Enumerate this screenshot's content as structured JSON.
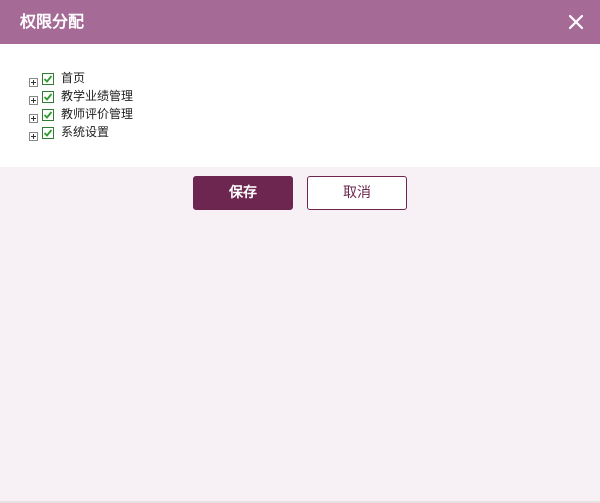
{
  "dialog": {
    "title": "权限分配",
    "close_icon": "close-icon"
  },
  "tree": {
    "items": [
      {
        "label": "首页",
        "checked": true,
        "expander_icon": "plus-box-icon",
        "checkbox_icon": "checked-box-icon"
      },
      {
        "label": "教学业绩管理",
        "checked": true,
        "expander_icon": "plus-box-icon",
        "checkbox_icon": "checked-box-icon"
      },
      {
        "label": "教师评价管理",
        "checked": true,
        "expander_icon": "plus-box-icon",
        "checkbox_icon": "checked-box-icon"
      },
      {
        "label": "系统设置",
        "checked": true,
        "expander_icon": "plus-box-icon",
        "checkbox_icon": "checked-box-icon"
      }
    ]
  },
  "buttons": {
    "save_label": "保存",
    "cancel_label": "取消"
  },
  "colors": {
    "titlebar": "#a66a97",
    "primary": "#6d2650",
    "check_green": "#2e9b2e",
    "background": "#f7f1f5"
  }
}
